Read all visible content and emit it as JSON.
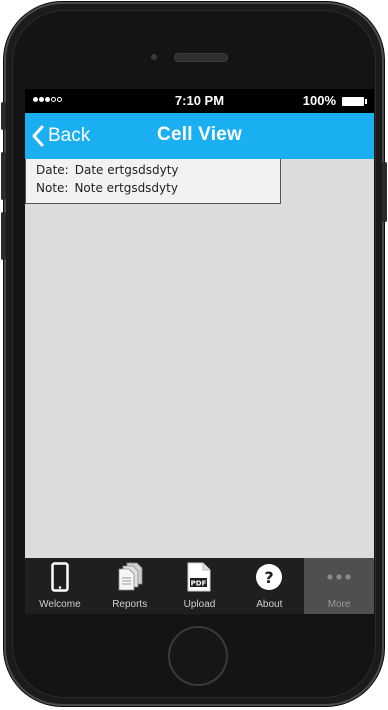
{
  "status_bar": {
    "time": "7:10 PM",
    "battery": "100%",
    "signal_dots": 5,
    "signal_filled": 3
  },
  "nav": {
    "back_label": "Back",
    "title": "Cell View"
  },
  "detail": {
    "rows": [
      {
        "key": "Date:",
        "value": "Date ertgsdsdyty"
      },
      {
        "key": "Note:",
        "value": "Note ertgsdsdyty"
      }
    ]
  },
  "tabs": [
    {
      "label": "Welcome",
      "icon": "phone-icon"
    },
    {
      "label": "Reports",
      "icon": "documents-icon"
    },
    {
      "label": "Upload",
      "icon": "pdf-icon"
    },
    {
      "label": "About",
      "icon": "question-icon"
    },
    {
      "label": "More",
      "icon": "more-icon",
      "active": true
    }
  ],
  "colors": {
    "accent": "#1aaff0",
    "screen_background": "#dcdcdc",
    "tab_bar": "#1f1f1f",
    "tab_active": "#4f4f4f"
  }
}
